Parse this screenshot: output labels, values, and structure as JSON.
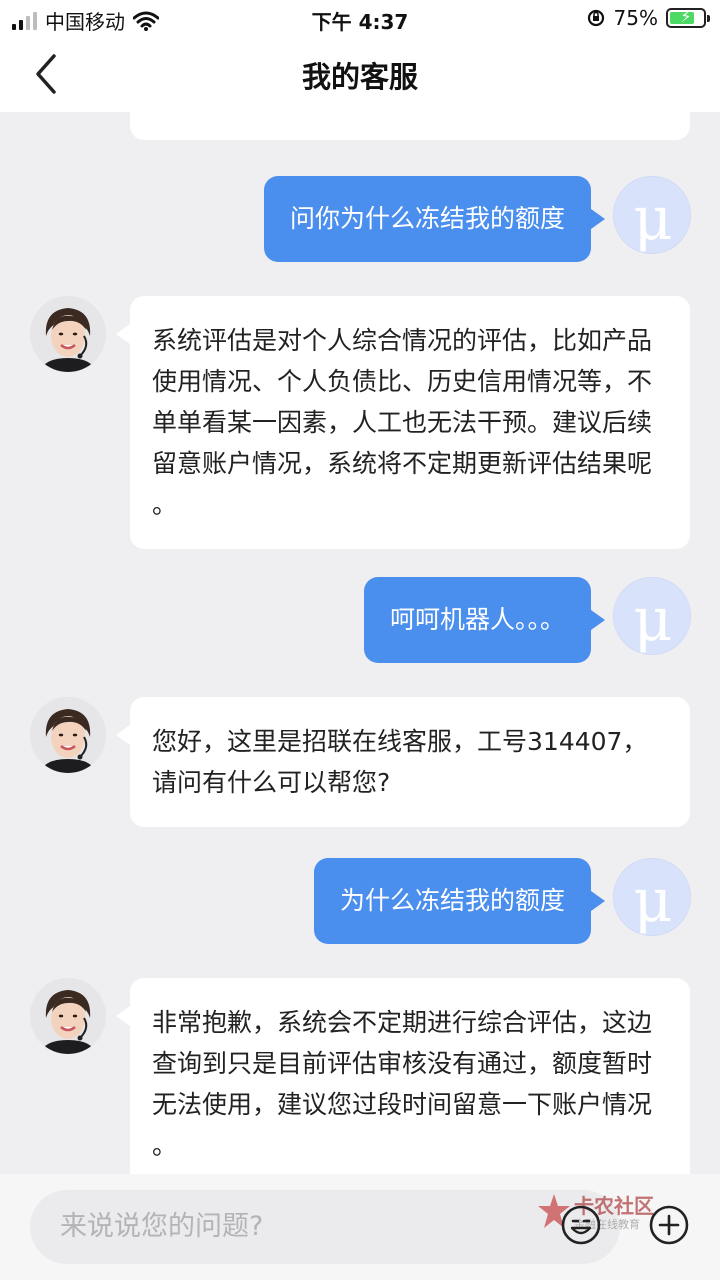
{
  "status_bar": {
    "carrier": "中国移动",
    "time": "下午 4:37",
    "battery_percent": "75%",
    "battery_level": 0.75
  },
  "nav": {
    "title": "我的客服"
  },
  "messages": [
    {
      "from": "user",
      "text": "问你为什么冻结我的额度"
    },
    {
      "from": "agent",
      "lines": [
        "系统评估是对个人综合情况的评估，比如产品",
        "使用情况、个人负债比、历史信用情况等，不",
        "单单看某一因素，人工也无法干预。建议后续",
        "留意账户情况，系统将不定期更新评估结果呢",
        "。"
      ]
    },
    {
      "from": "user",
      "text": "呵呵机器人。。。"
    },
    {
      "from": "agent",
      "lines": [
        "您好，这里是招联在线客服，工号314407，",
        "请问有什么可以帮您?"
      ]
    },
    {
      "from": "user",
      "text": "为什么冻结我的额度"
    },
    {
      "from": "agent",
      "lines": [
        "非常抱歉，系统会不定期进行综合评估，这边",
        "查询到只是目前评估审核没有通过，额度暂时",
        "无法使用，建议您过段时间留意一下账户情况",
        "。"
      ]
    }
  ],
  "input": {
    "placeholder": "来说说您的问题?"
  },
  "watermark": {
    "title": "卡农社区",
    "subtitle": "金融在线教育"
  },
  "colors": {
    "user_bubble": "#4a8eee",
    "agent_bubble": "#ffffff",
    "background": "#efeff1"
  }
}
